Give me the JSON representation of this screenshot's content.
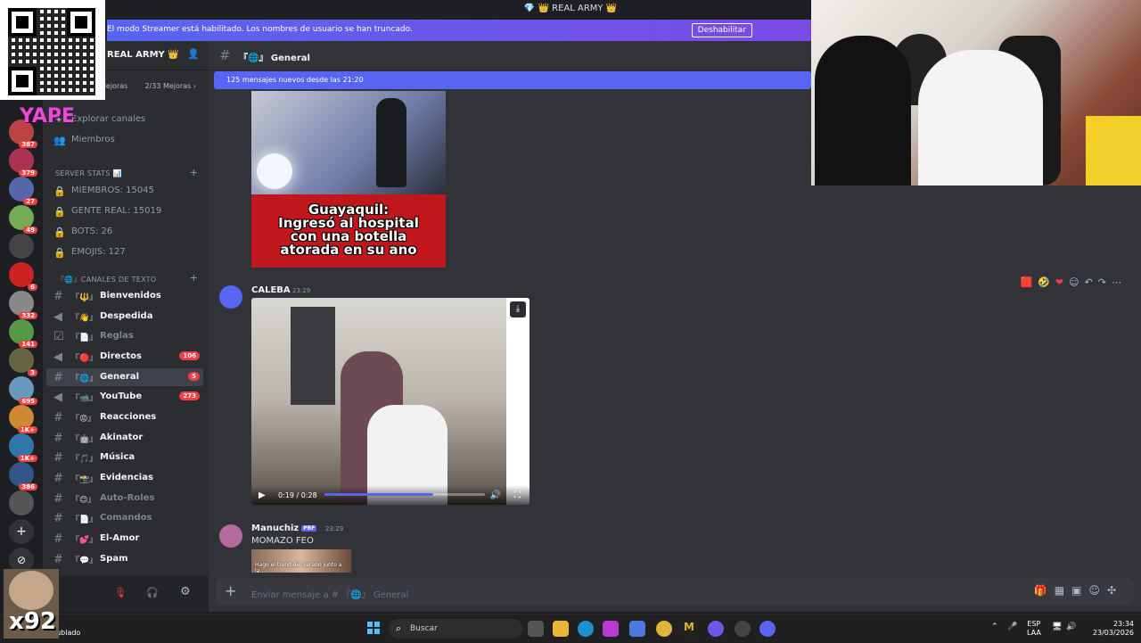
{
  "window": {
    "title": "💎 👑 REAL ARMY 👑"
  },
  "streamer_banner": {
    "message": "El modo Streamer está habilitado. Los nombres de usuario se han truncado.",
    "disable_label": "Deshabilitar"
  },
  "server": {
    "name": "REAL ARMY 👑",
    "boost_label": "Mejoras",
    "boost_count": "2/33 Mejoras ›"
  },
  "sidebar": {
    "explore_label": "Explorar canales",
    "members_label": "Miembros",
    "stats_category": "SERVER STATS 📊",
    "stats": [
      "MIEMBROS: 15045",
      "GENTE REAL: 15019",
      "BOTS: 26",
      "EMOJIS: 127"
    ],
    "text_category": "『🌐』CANALES DE TEXTO",
    "channels": [
      {
        "emoji": "『🔱』",
        "name": "Bienvenidos",
        "badge": ""
      },
      {
        "emoji": "『👋』",
        "name": "Despedida",
        "badge": ""
      },
      {
        "emoji": "『📄』",
        "name": "Reglas",
        "badge": ""
      },
      {
        "emoji": "『🔴』",
        "name": "Directos",
        "badge": "106"
      },
      {
        "emoji": "『🌐』",
        "name": "General",
        "badge": "5"
      },
      {
        "emoji": "『📹』",
        "name": "YouTube",
        "badge": "273"
      },
      {
        "emoji": "『😡』",
        "name": "Reacciones",
        "badge": ""
      },
      {
        "emoji": "『🤖』",
        "name": "Akinator",
        "badge": ""
      },
      {
        "emoji": "『🎵』",
        "name": "Música",
        "badge": ""
      },
      {
        "emoji": "『📸』",
        "name": "Evidencias",
        "badge": ""
      },
      {
        "emoji": "『😊』",
        "name": "Auto-Roles",
        "badge": ""
      },
      {
        "emoji": "『📄』",
        "name": "Comandos",
        "badge": ""
      },
      {
        "emoji": "『💕』",
        "name": "El-Amor",
        "badge": ""
      },
      {
        "emoji": "『💬』",
        "name": "Spam",
        "badge": ""
      }
    ]
  },
  "server_badges": [
    "387",
    "379",
    "27",
    "49",
    "6",
    "332",
    "141",
    "3",
    "695",
    "1K+",
    "1K+",
    "386"
  ],
  "chat": {
    "channel_name": "『🌐』 General",
    "new_messages": "125 mensajes nuevos desde las 21:20",
    "image_caption": "Guayaquil:\nIngresó al hospital\ncon una botella\natorada en su ano",
    "msg1": {
      "author": "CALEBA",
      "time": "23:29",
      "video_time": "0:19 / 0:28",
      "progress": 0.68
    },
    "msg2": {
      "author": "Manuchiz",
      "tag": "PBF",
      "time": "23:29",
      "text": "MOMAZO FEO",
      "thumb_text": "Hago el trend del verano junto a la..."
    },
    "composer_placeholder": "Enviar mensaje a # 『🌐』 General"
  },
  "taskbar": {
    "weather": "nublado",
    "search_label": "Buscar",
    "lang": "ESP\nLAA",
    "time": "23:34",
    "date": "23/03/2026"
  },
  "overlays": {
    "yape": "YAPE",
    "counter": "x92"
  },
  "colors": {
    "blurple": "#5865f2",
    "danger": "#f23f43",
    "accent_purple": "#7b49e6"
  }
}
